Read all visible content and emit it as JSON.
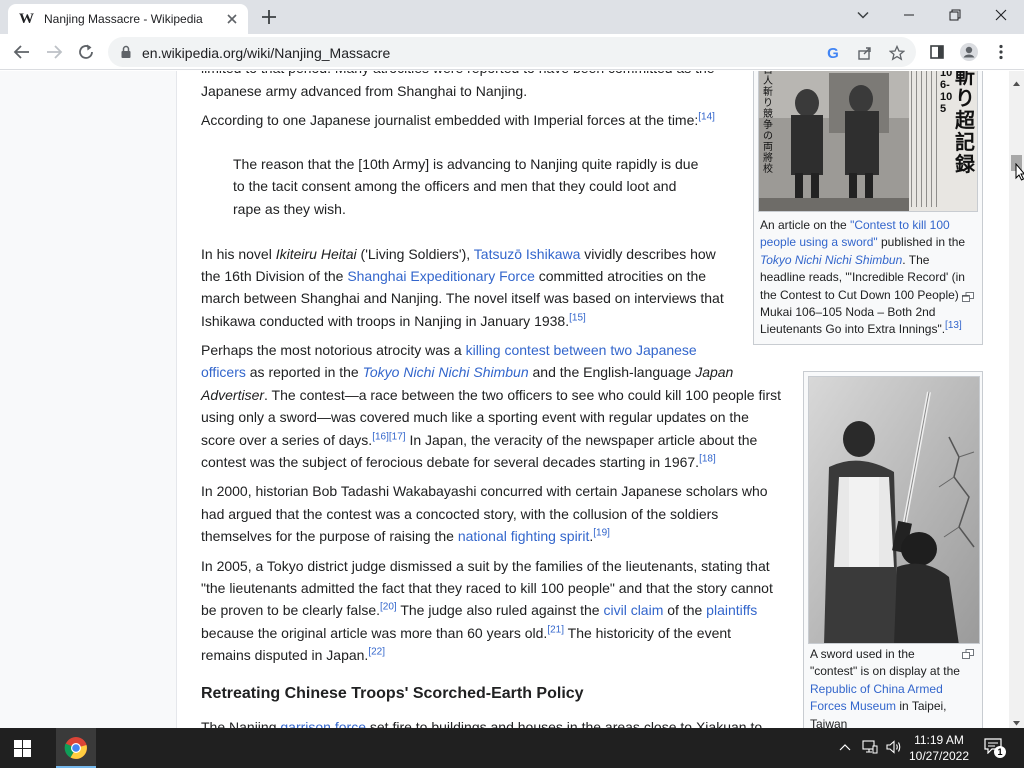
{
  "browser": {
    "tab_title": "Nanjing Massacre - Wikipedia",
    "favicon_letter": "W",
    "url": "en.wikipedia.org/wiki/Nanjing_Massacre",
    "omnibox_google_letter": "G"
  },
  "article": {
    "top_fragment": "limited to that period. Many atrocities were reported to have been committed as the",
    "p0_line2": "Japanese army advanced from Shanghai to Nanjing.",
    "p1_text": "According to one Japanese journalist embedded with Imperial forces at the time:",
    "p1_ref": "[14]",
    "quote_lines": [
      "The reason that the [10th Army] is advancing to Nanjing quite rapidly is due",
      "to the tacit consent among the officers and men that they could loot and",
      "rape as they wish."
    ],
    "p2": {
      "a": "In his novel ",
      "b_italic": "Ikiteiru Heitai",
      "c": " ('Living Soldiers'), ",
      "d_link": "Tatsuzō Ishikawa",
      "e": " vividly describes how",
      "f": "the 16th Division of the ",
      "g_link": "Shanghai Expeditionary Force",
      "h": " committed atrocities on the",
      "i": "march between Shanghai and Nanjing. The novel itself was based on interviews that",
      "j": "Ishikawa conducted with troops in Nanjing in January 1938.",
      "ref": "[15]"
    },
    "p3": {
      "a": "Perhaps the most notorious atrocity was a ",
      "b_link": "killing contest between two Japanese",
      "c_link": "officers",
      "d": " as reported in the ",
      "e_link": "Tokyo Nichi Nichi Shimbun",
      "f": " and the English-language ",
      "g_italic": "Japan",
      "h_italic": "Advertiser",
      "i": ". The contest—a race between the two officers to see who could kill 100 people first",
      "j": "using only a sword—was covered much like a sporting event with regular updates on the",
      "k": "score over a series of days.",
      "ref1": "[16]",
      "ref2": "[17]",
      "l": " In Japan, the veracity of the newspaper article about the",
      "m": "contest was the subject of ferocious debate for several decades starting in 1967.",
      "ref3": "[18]"
    },
    "p4": {
      "a": "In 2000, historian Bob Tadashi Wakabayashi concurred with certain Japanese scholars who",
      "b": "had argued that the contest was a concocted story, with the collusion of the soldiers",
      "c": "themselves for the purpose of raising the ",
      "d_link": "national fighting spirit",
      "e": ".",
      "ref": "[19]"
    },
    "p5": {
      "a": "In 2005, a Tokyo district judge dismissed a suit by the families of the lieutenants, stating that",
      "b": "\"the lieutenants admitted the fact that they raced to kill 100 people\" and that the story cannot",
      "c": "be proven to be clearly false.",
      "ref1": "[20]",
      "d": " The judge also ruled against the ",
      "e_link": "civil claim",
      "f": " of the ",
      "g_link": "plaintiffs",
      "h": "because the original article was more than 60 years old.",
      "ref2": "[21]",
      "i": " The historicity of the event",
      "j": "remains disputed in Japan.",
      "ref3": "[22]"
    },
    "heading": "Retreating Chinese Troops' Scorched-Earth Policy",
    "bottom_fragment": {
      "a": "The Nanjing ",
      "b_link": "garrison force",
      "c": " set fire to buildings and houses in the areas close to Xiakuan to"
    }
  },
  "figure1": {
    "headline_big": "斬り超記録",
    "headline_small": "百人斬り競争の両將校",
    "headline_nums": "106-105",
    "caption": {
      "a": "An article on the ",
      "b_link": "\"Contest to kill 100",
      "c_link": "people using a sword\"",
      "d": " published in the",
      "e_italic_link": "Tokyo Nichi Nichi Shimbun",
      "f": ". The",
      "g": "headline reads, \"'Incredible Record' (in",
      "h": "the Contest to Cut Down 100 People) –",
      "i": "Mukai 106–105 Noda – Both 2nd",
      "j": "Lieutenants Go into Extra Innings\".",
      "ref": "[13]"
    }
  },
  "figure2": {
    "caption": {
      "a": "A sword used in the",
      "b": "\"contest\" is on display at the",
      "c_link": "Republic of China Armed",
      "d_link": "Forces Museum",
      "e": " in Taipei,",
      "f": "Taiwan"
    }
  },
  "taskbar": {
    "time": "11:19 AM",
    "date": "10/27/2022",
    "notification_count": "1"
  }
}
